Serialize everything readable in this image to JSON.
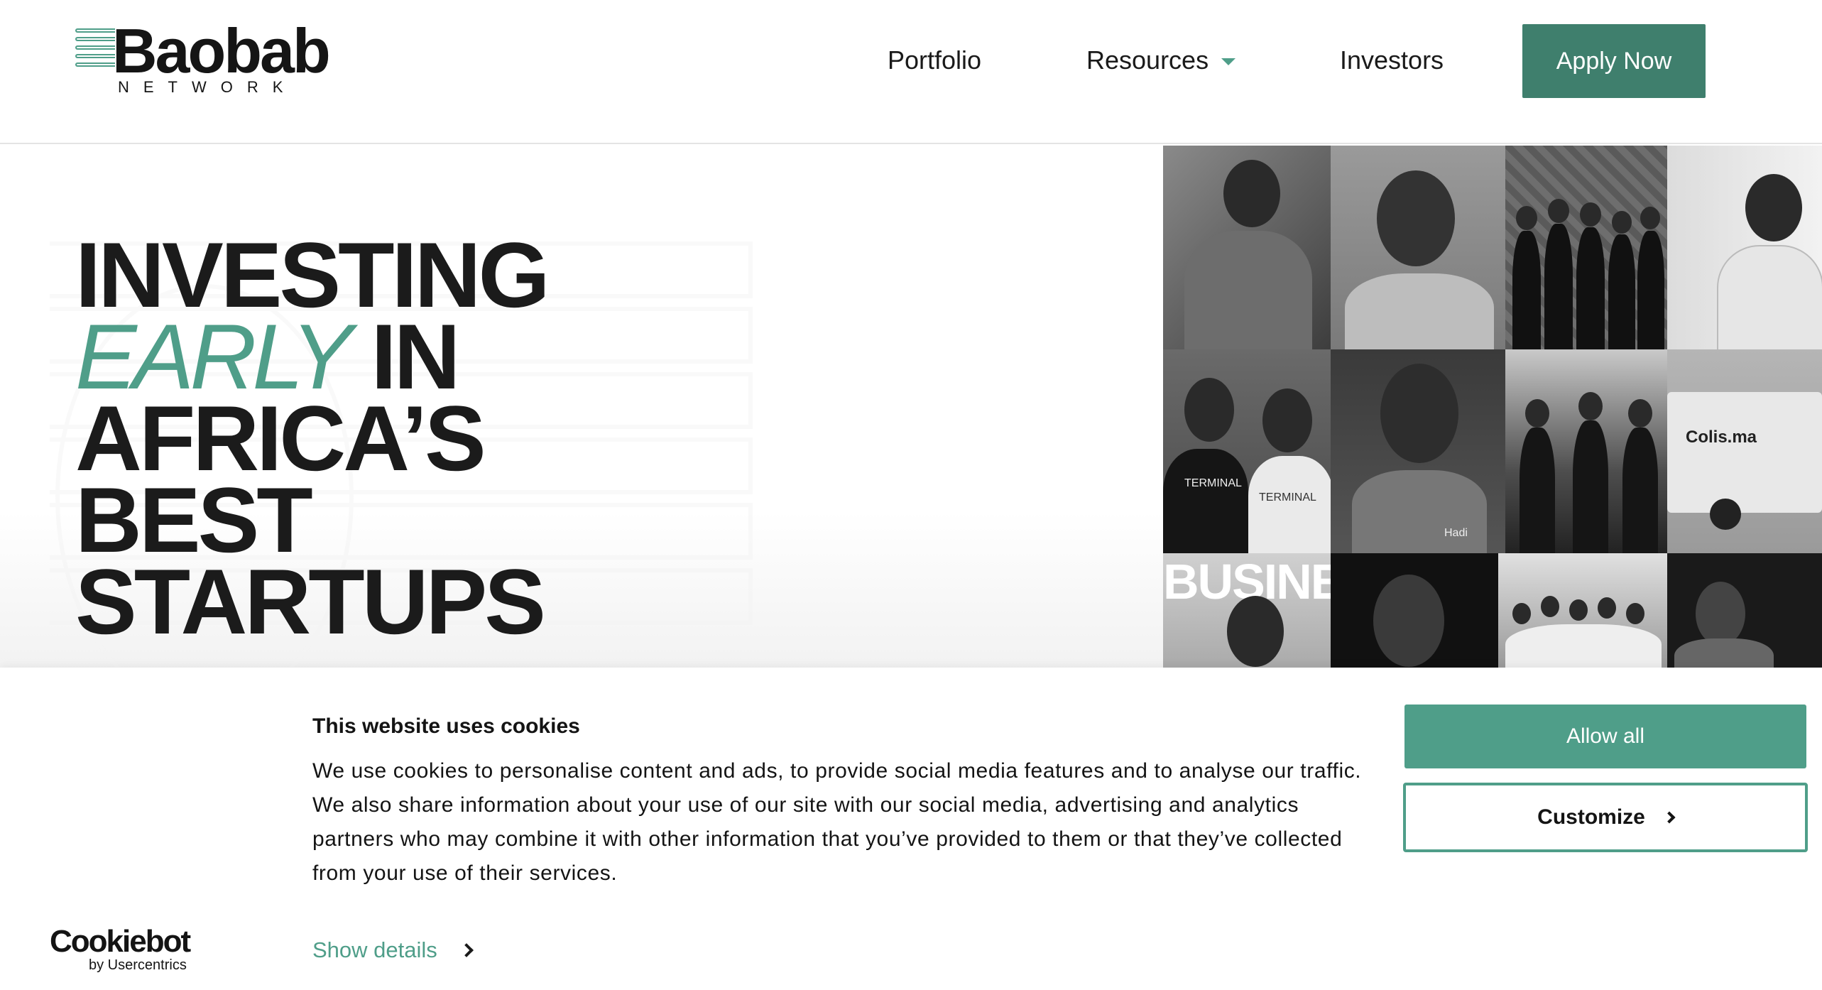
{
  "header": {
    "logo_word": "Baobab",
    "logo_sub": "NETWORK",
    "nav": {
      "portfolio": "Portfolio",
      "resources": "Resources",
      "investors": "Investors"
    },
    "apply_label": "Apply Now"
  },
  "hero": {
    "line1": "INVESTING",
    "line2_accent": "EARLY",
    "line2_rest": "IN",
    "line3": "AFRICA’S",
    "line4": "BEST",
    "line5": "STARTUPS"
  },
  "photos": {
    "terminal_1": "TERMINAL",
    "terminal_2": "TERMINAL",
    "hadi": "Hadi",
    "colis": "Colis.ma",
    "business": "BUSINE"
  },
  "cookie": {
    "title": "This website uses cookies",
    "body": "We use cookies to personalise content and ads, to provide social media features and to analyse our traffic. We also share information about your use of our site with our social media, advertising and analytics partners who may combine it with other information that you’ve provided to them or that they’ve collected from your use of their services.",
    "show_details": "Show details",
    "allow_all": "Allow all",
    "customize": "Customize",
    "brand": "Cookiebot",
    "brand_sub": "by Usercentrics"
  },
  "colors": {
    "accent": "#4f9e89",
    "button_dark": "#3f7f6d",
    "text": "#1b1b1b"
  }
}
